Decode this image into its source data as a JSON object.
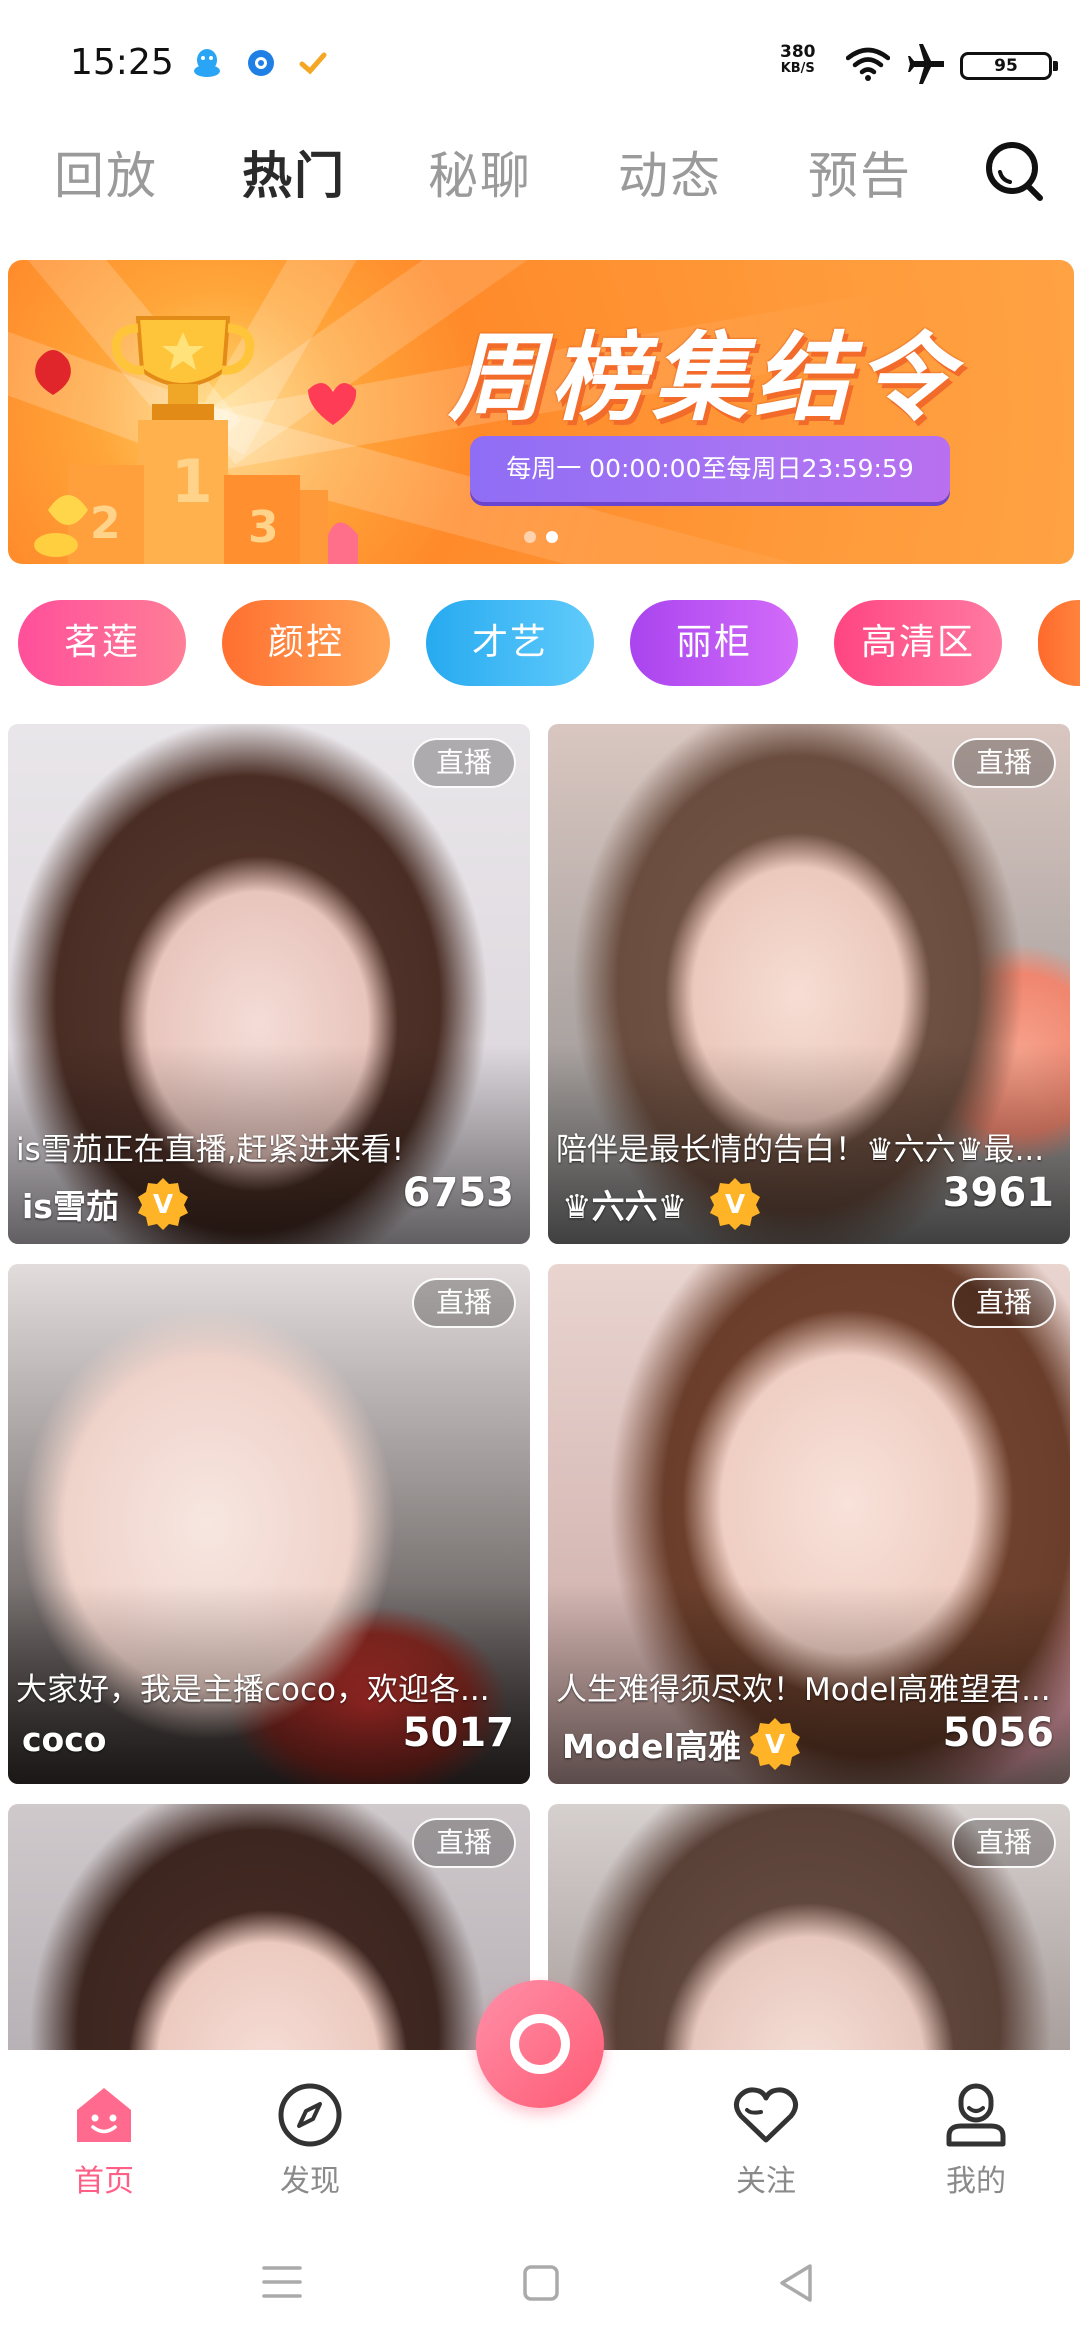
{
  "status_bar": {
    "time": "15:25",
    "net_speed_value": "380",
    "net_speed_unit": "KB/S",
    "battery": "95"
  },
  "top_tabs": [
    {
      "label": "回放",
      "active": false
    },
    {
      "label": "热门",
      "active": true
    },
    {
      "label": "秘聊",
      "active": false
    },
    {
      "label": "动态",
      "active": false
    },
    {
      "label": "预告",
      "active": false
    }
  ],
  "banner": {
    "title": "周榜集结令",
    "subtitle": "每周一 00:00:00至每周日23:59:59"
  },
  "categories": [
    {
      "label": "茗莲",
      "color_from": "#ff5fa2",
      "color_to": "#ff7f98"
    },
    {
      "label": "颜控",
      "color_from": "#ff7a3a",
      "color_to": "#ffa55a"
    },
    {
      "label": "才艺",
      "color_from": "#2fb0f2",
      "color_to": "#5cc8fb"
    },
    {
      "label": "丽柜",
      "color_from": "#b04cf0",
      "color_to": "#d26df8"
    },
    {
      "label": "高清区",
      "color_from": "#ff4f86",
      "color_to": "#ff7aa2"
    }
  ],
  "cards": [
    {
      "badge": "直播",
      "desc": "is雪茄正在直播,赶紧进来看!",
      "name": "is雪茄",
      "verified": true,
      "count": "6753"
    },
    {
      "badge": "直播",
      "desc": "陪伴是最长情的告白！♛六六♛最...",
      "name": "♛六六♛",
      "verified": true,
      "count": "3961"
    },
    {
      "badge": "直播",
      "desc": "大家好，我是主播coco，欢迎各...",
      "name": "coco",
      "verified": false,
      "count": "5017"
    },
    {
      "badge": "直播",
      "desc": "人生难得须尽欢！Model高雅望君...",
      "name": "Model高雅",
      "verified": true,
      "count": "5056"
    },
    {
      "badge": "直播",
      "desc": "",
      "name": "",
      "verified": false,
      "count": ""
    },
    {
      "badge": "直播",
      "desc": "",
      "name": "",
      "verified": false,
      "count": ""
    }
  ],
  "bottom_nav": [
    {
      "label": "首页",
      "icon": "home-icon",
      "active": true
    },
    {
      "label": "发现",
      "icon": "compass-icon",
      "active": false
    },
    {
      "label": "关注",
      "icon": "heart-icon",
      "active": false
    },
    {
      "label": "我的",
      "icon": "profile-icon",
      "active": false
    }
  ],
  "colors": {
    "accent": "#ff5f86",
    "tab_inactive": "#9a9a9a",
    "tab_active": "#2a2a2a"
  }
}
